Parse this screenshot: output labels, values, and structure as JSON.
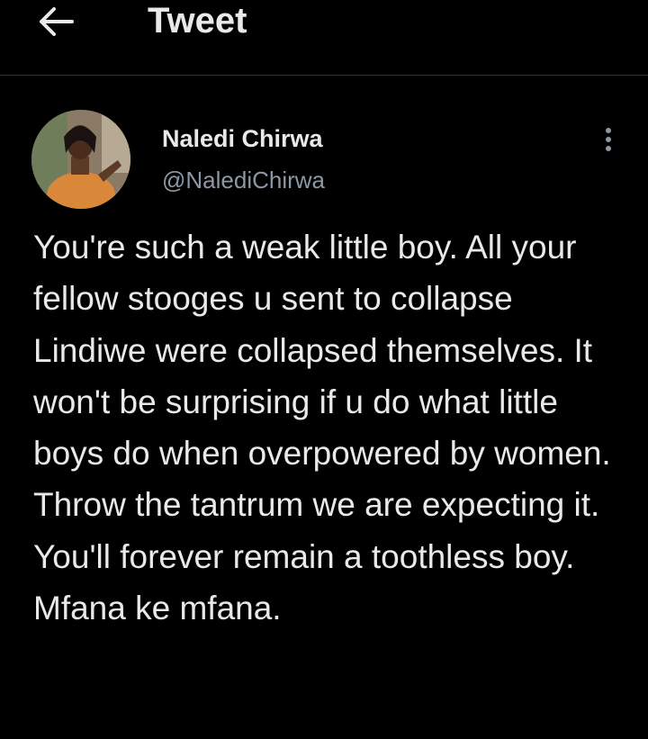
{
  "header": {
    "title": "Tweet",
    "back_icon": "arrow-left-icon"
  },
  "author": {
    "name": "Naledi Chirwa",
    "handle": "@NalediChirwa",
    "avatar": "profile-photo",
    "more_icon": "more-vertical-icon"
  },
  "tweet": {
    "text": "You're such a weak little boy. All your fellow stooges u sent to collapse Lindiwe were collapsed themselves. It won't be surprising if u do what little boys do when overpowered by women. Throw the tantrum we are expecting it. You'll forever remain a toothless boy. Mfana ke mfana."
  },
  "colors": {
    "background": "#000000",
    "primary_text": "#e7e9ea",
    "secondary_text": "#8b98a5",
    "divider": "#2f3336"
  }
}
